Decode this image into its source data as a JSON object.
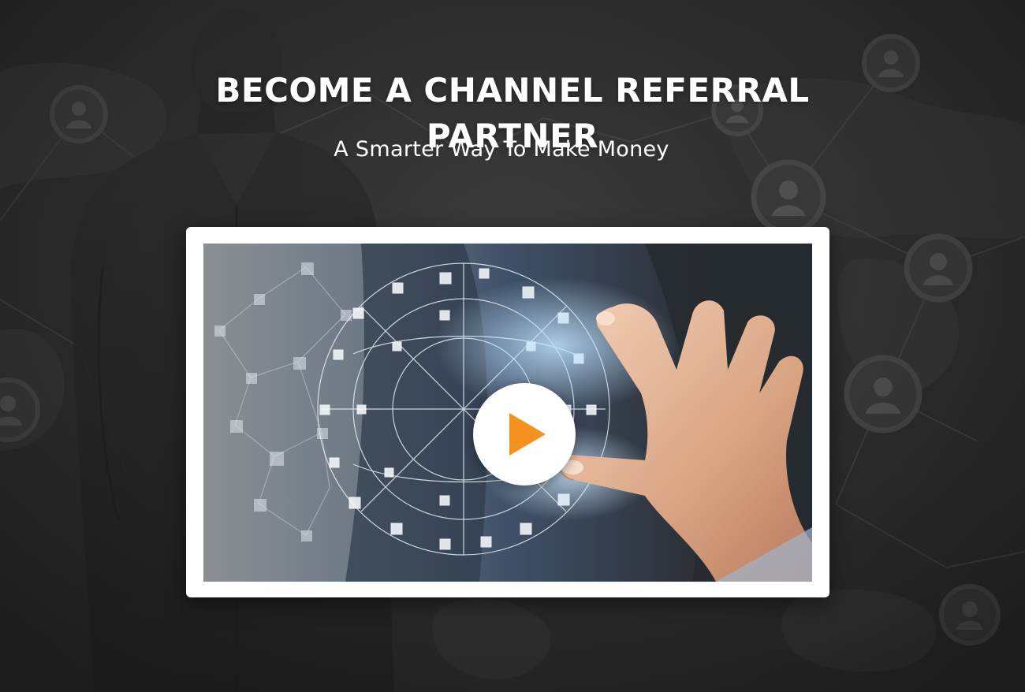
{
  "hero": {
    "title_line_1": "BECOME A CHANNEL REFERRAL",
    "title_line_2": "PARTNER",
    "subtitle": "A Smarter Way To Make Money"
  },
  "video": {
    "play_icon": "play-icon",
    "accent_color": "#f5921f"
  },
  "background": {
    "icons": [
      "person-icon",
      "world-map",
      "network-lines"
    ]
  }
}
